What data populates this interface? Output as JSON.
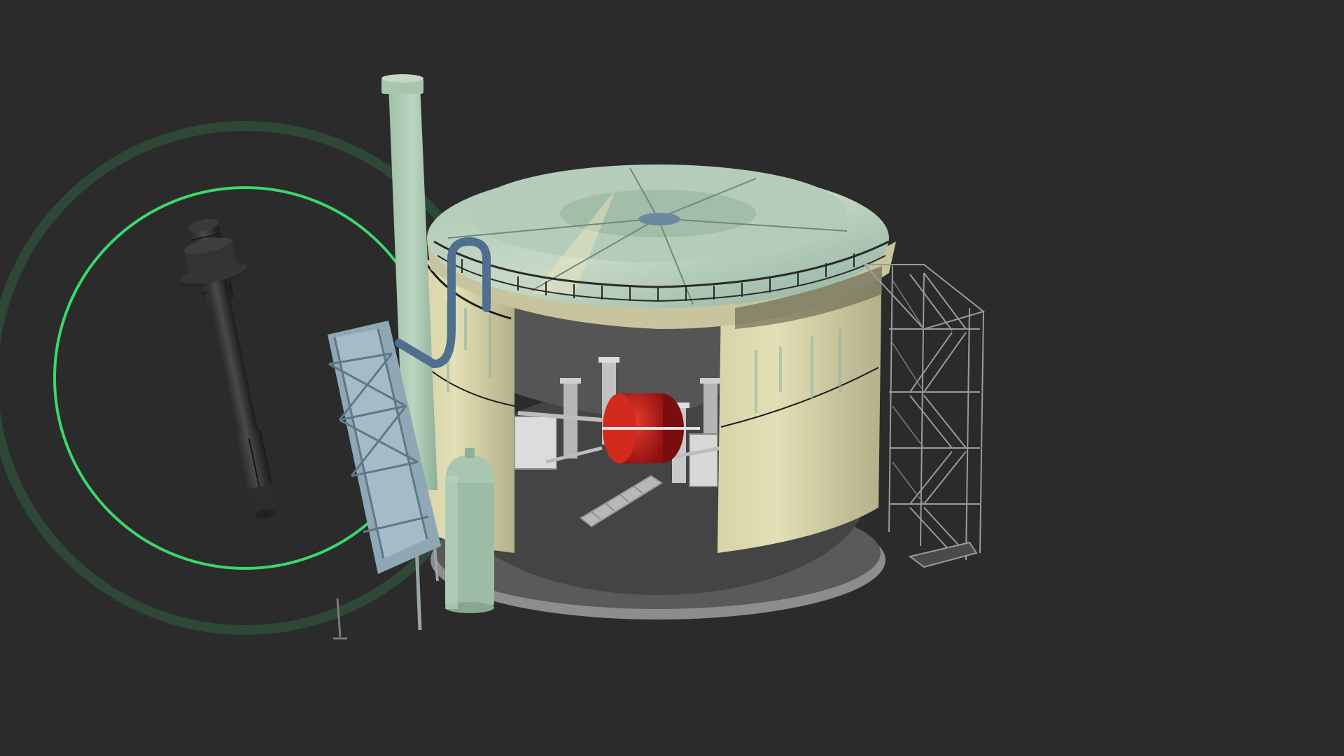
{
  "scene": {
    "background_color": "#2b2b2b",
    "highlight_color": "#39d96a",
    "highlight_outer_color": "#2f4a38",
    "objects": [
      "anchor-bolt",
      "storage-tank-cutaway",
      "exhaust-stack",
      "support-structure",
      "gas-cylinder",
      "red-vessel",
      "exterior-staircase",
      "railing"
    ]
  }
}
